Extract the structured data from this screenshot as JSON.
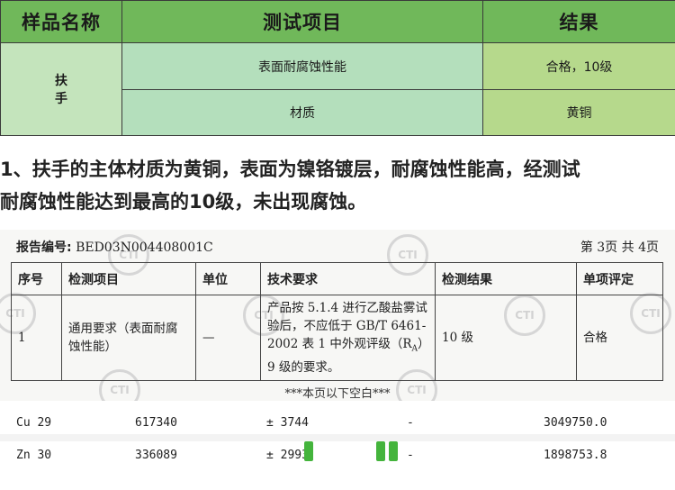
{
  "summary": {
    "headers": {
      "sample": "样品名称",
      "item": "测试项目",
      "result": "结果"
    },
    "sample_name_line1": "扶",
    "sample_name_line2": "手",
    "rows": [
      {
        "item": "表面耐腐蚀性能",
        "result": "合格，10级"
      },
      {
        "item": "材质",
        "result": "黄铜"
      }
    ],
    "colors": {
      "header": "#70b85a",
      "item_cell": "#b4dfbc",
      "result_cell": "#b6d98c",
      "sample_cell": "#c4e4bc"
    }
  },
  "description": {
    "line1": "1、扶手的主体材质为黄铜，表面为镍铬镀层，耐腐蚀性能高，经测试",
    "line2": "耐腐蚀性能达到最高的10级，未出现腐蚀。"
  },
  "report": {
    "number_label": "报告编号:",
    "number_value": "BED03N004408001C",
    "page": "第 3页  共 4页",
    "watermark": "CTI",
    "headers": [
      "序号",
      "检测项目",
      "单位",
      "技术要求",
      "检测结果",
      "单项评定"
    ],
    "row": {
      "seq": "1",
      "item": "通用要求（表面耐腐蚀性能）",
      "unit": "—",
      "req_part1": "产品按 5.1.4 进行乙酸盐雾试验后，不应低于 GB/T 6461-2002 表 1 中外观评级（R",
      "req_sub": "A",
      "req_part2": "）9 级的要求。",
      "result": "10 级",
      "eval": "合格"
    },
    "blank_note": "***本页以下空白***"
  },
  "data_rows": [
    {
      "element": "Cu 29",
      "count": "617340",
      "err": "± 3744",
      "dash": "-",
      "value": "3049750.0"
    },
    {
      "element": "Zn 30",
      "count": "336089",
      "err": "± 2993",
      "dash": "-",
      "value": "1898753.8"
    }
  ]
}
